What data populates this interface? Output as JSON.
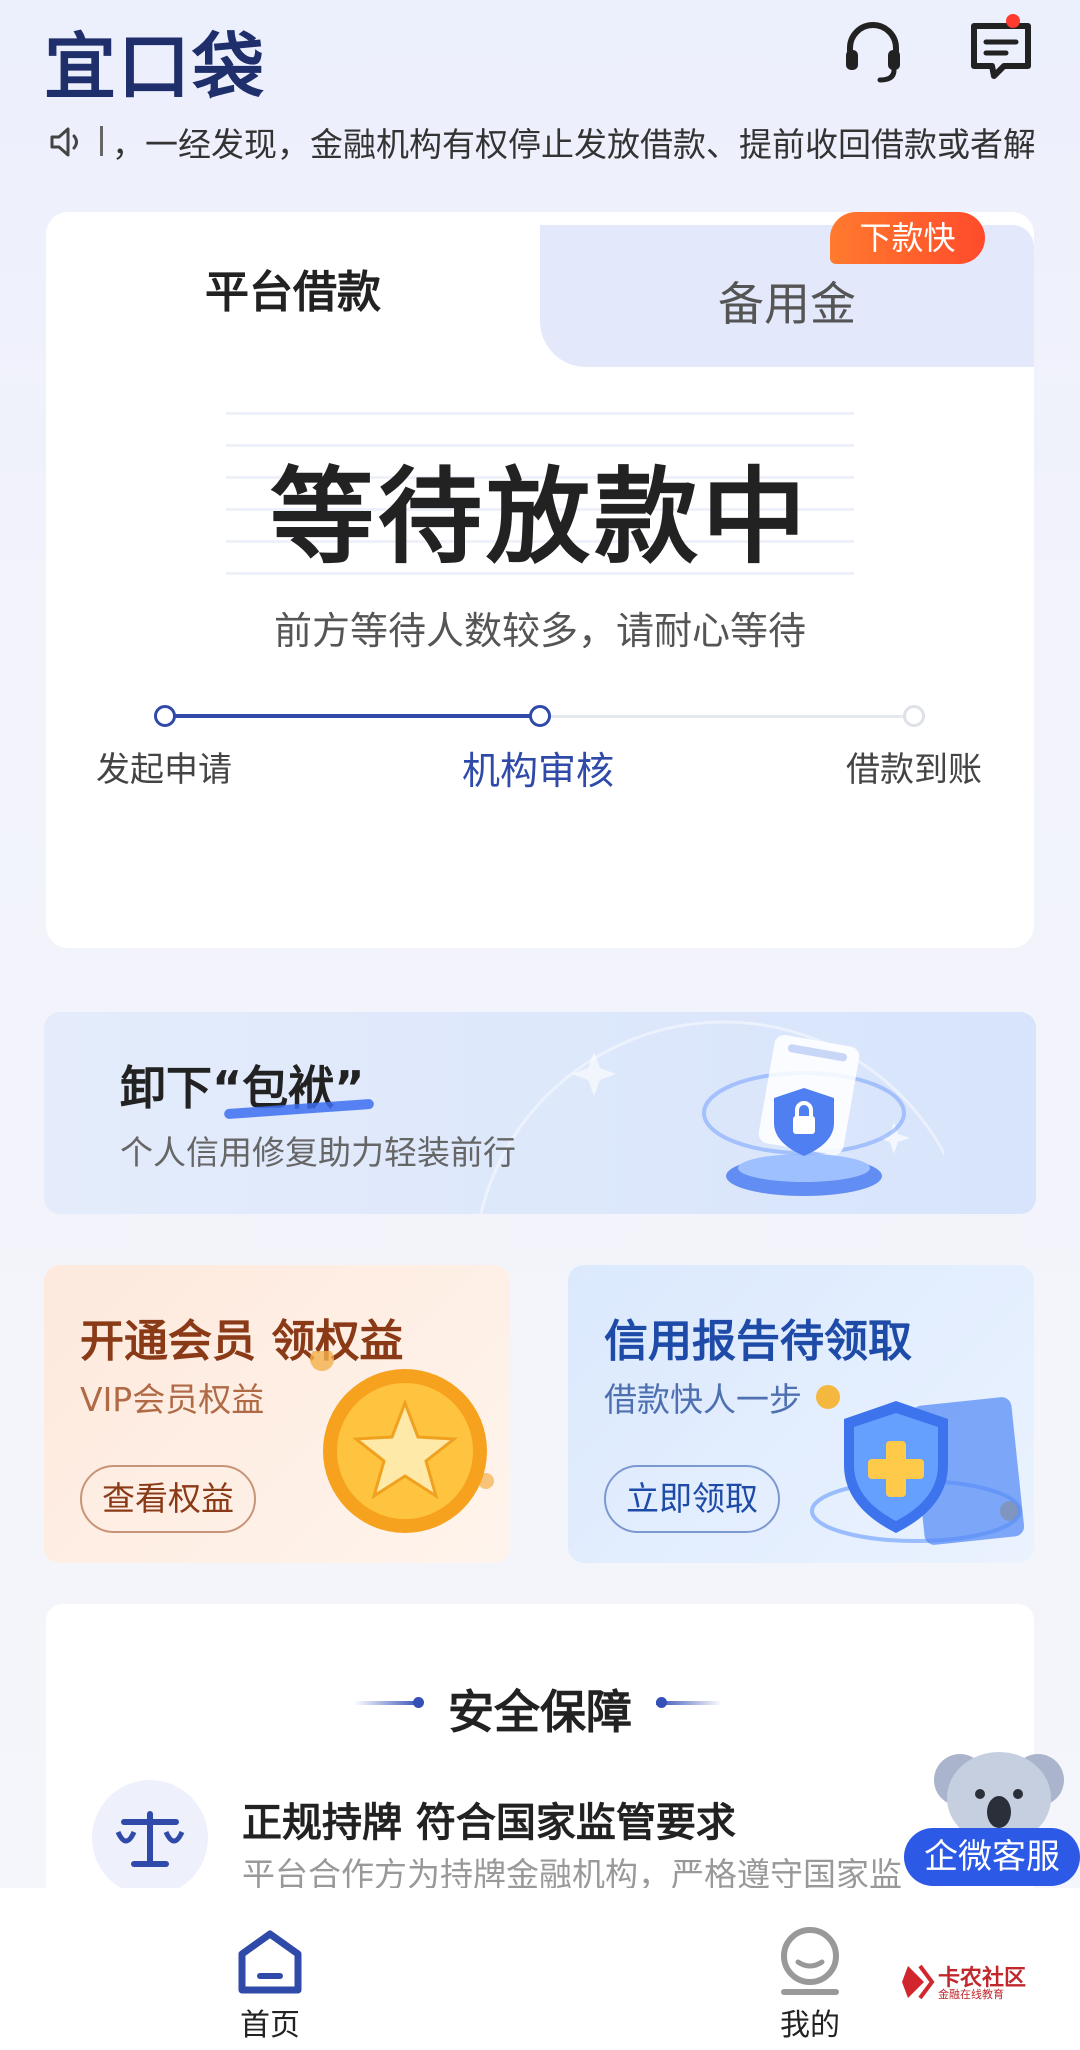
{
  "header": {
    "logo": "宜口袋",
    "has_unread": true
  },
  "notice": {
    "text": "，一经发现，金融机构有权停止发放借款、提前收回借款或者解除"
  },
  "loan": {
    "tabs": [
      {
        "label": "平台借款",
        "active": true
      },
      {
        "label": "备用金",
        "active": false
      }
    ],
    "badge": "下款快",
    "status_title": "等待放款中",
    "status_subtitle": "前方等待人数较多，请耐心等待",
    "steps": [
      {
        "label": "发起申请",
        "state": "done"
      },
      {
        "label": "机构审核",
        "state": "current"
      },
      {
        "label": "借款到账",
        "state": "todo"
      }
    ]
  },
  "banner": {
    "title": "卸下“包袱”",
    "subtitle": "个人信用修复助力轻装前行"
  },
  "promos": [
    {
      "title": "开通会员 领权益",
      "subtitle": "VIP会员权益",
      "button": "查看权益"
    },
    {
      "title": "信用报告待领取",
      "subtitle": "借款快人一步",
      "button": "立即领取"
    }
  ],
  "security": {
    "title": "安全保障",
    "item_title": "正规持牌 符合国家监管要求",
    "item_desc": "平台合作方为持牌金融机构，严格遵守国家监"
  },
  "float_service": {
    "label": "企微客服"
  },
  "nav": [
    {
      "label": "首页",
      "active": true
    },
    {
      "label": "我的",
      "active": false
    }
  ],
  "watermark": {
    "title": "卡农社区",
    "subtitle": "金融在线教育"
  },
  "colors": {
    "primary": "#2f4aa9",
    "accent_orange": "#ff5a2b",
    "service_blue": "#2c59e6"
  }
}
